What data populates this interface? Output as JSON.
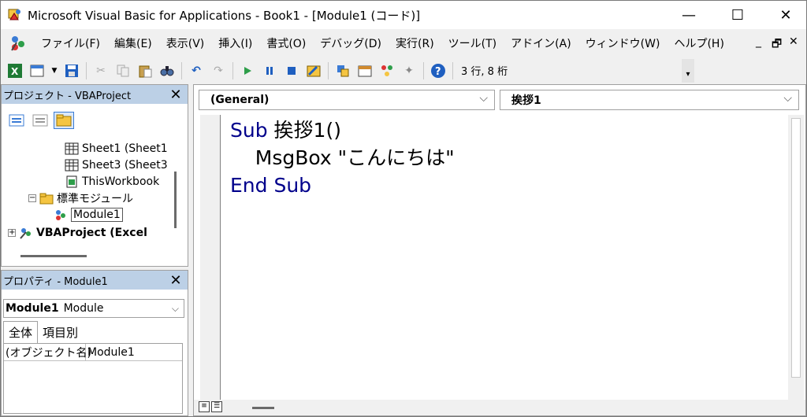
{
  "window": {
    "title": "Microsoft Visual Basic for Applications - Book1 - [Module1 (コード)]",
    "minimize": "—",
    "maximize": "☐",
    "close": "✕"
  },
  "menubar": {
    "items": [
      "ファイル(F)",
      "編集(E)",
      "表示(V)",
      "挿入(I)",
      "書式(O)",
      "デバッグ(D)",
      "実行(R)",
      "ツール(T)",
      "アドイン(A)",
      "ウィンドウ(W)",
      "ヘルプ(H)"
    ],
    "mdi_minimize": "_",
    "mdi_restore": "🗗",
    "mdi_close": "✕"
  },
  "toolbar": {
    "position": "3 行, 8 桁",
    "accent_green": "#1f7a35",
    "accent_blue": "#1f5fc0"
  },
  "project_panel": {
    "title": "プロジェクト - VBAProject",
    "close": "✕",
    "tree": [
      "Sheet1 (Sheet1",
      "Sheet3 (Sheet3",
      "ThisWorkbook",
      "標準モジュール",
      "Module1",
      "VBAProject (Excel"
    ]
  },
  "properties_panel": {
    "title": "プロパティ - Module1",
    "close": "✕",
    "object_name": "Module1",
    "object_type": "Module",
    "tabs": [
      "全体",
      "項目別"
    ],
    "rows": [
      {
        "key": "(オブジェクト名)",
        "value": "Module1"
      }
    ]
  },
  "code_window": {
    "object_combo": "(General)",
    "proc_combo": "挨拶1",
    "lines": {
      "l1_kw": "Sub",
      "l1_rest": " 挨拶1()",
      "l2": "    MsgBox \"こんにちは\"",
      "l3_kw": "End Sub"
    },
    "keyword_color": "#00008b"
  }
}
